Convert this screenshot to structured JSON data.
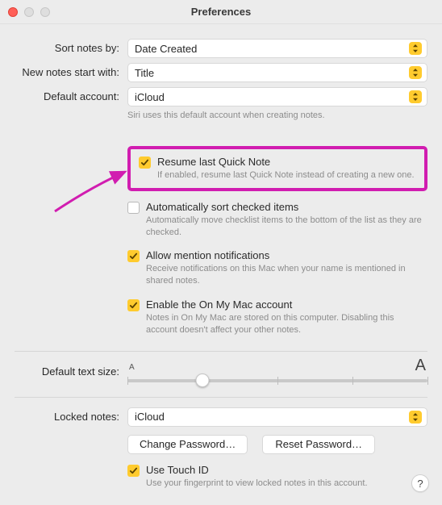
{
  "window": {
    "title": "Preferences"
  },
  "sort": {
    "label": "Sort notes by:",
    "value": "Date Created"
  },
  "newNotes": {
    "label": "New notes start with:",
    "value": "Title"
  },
  "defaultAccount": {
    "label": "Default account:",
    "value": "iCloud",
    "hint": "Siri uses this default account when creating notes."
  },
  "resumeQN": {
    "checked": true,
    "label": "Resume last Quick Note",
    "hint": "If enabled, resume last Quick Note instead of creating a new one."
  },
  "autoSort": {
    "checked": false,
    "label": "Automatically sort checked items",
    "hint": "Automatically move checklist items to the bottom of the list as they are checked."
  },
  "mentions": {
    "checked": true,
    "label": "Allow mention notifications",
    "hint": "Receive notifications on this Mac when your name is mentioned in shared notes."
  },
  "onMyMac": {
    "checked": true,
    "label": "Enable the On My Mac account",
    "hint": "Notes in On My Mac are stored on this computer. Disabling this account doesn't affect your other notes."
  },
  "textSize": {
    "label": "Default text size:",
    "small": "A",
    "large": "A"
  },
  "locked": {
    "label": "Locked notes:",
    "value": "iCloud",
    "changeBtn": "Change Password…",
    "resetBtn": "Reset Password…"
  },
  "touchID": {
    "checked": true,
    "label": "Use Touch ID",
    "hint": "Use your fingerprint to view locked notes in this account."
  },
  "help": "?"
}
